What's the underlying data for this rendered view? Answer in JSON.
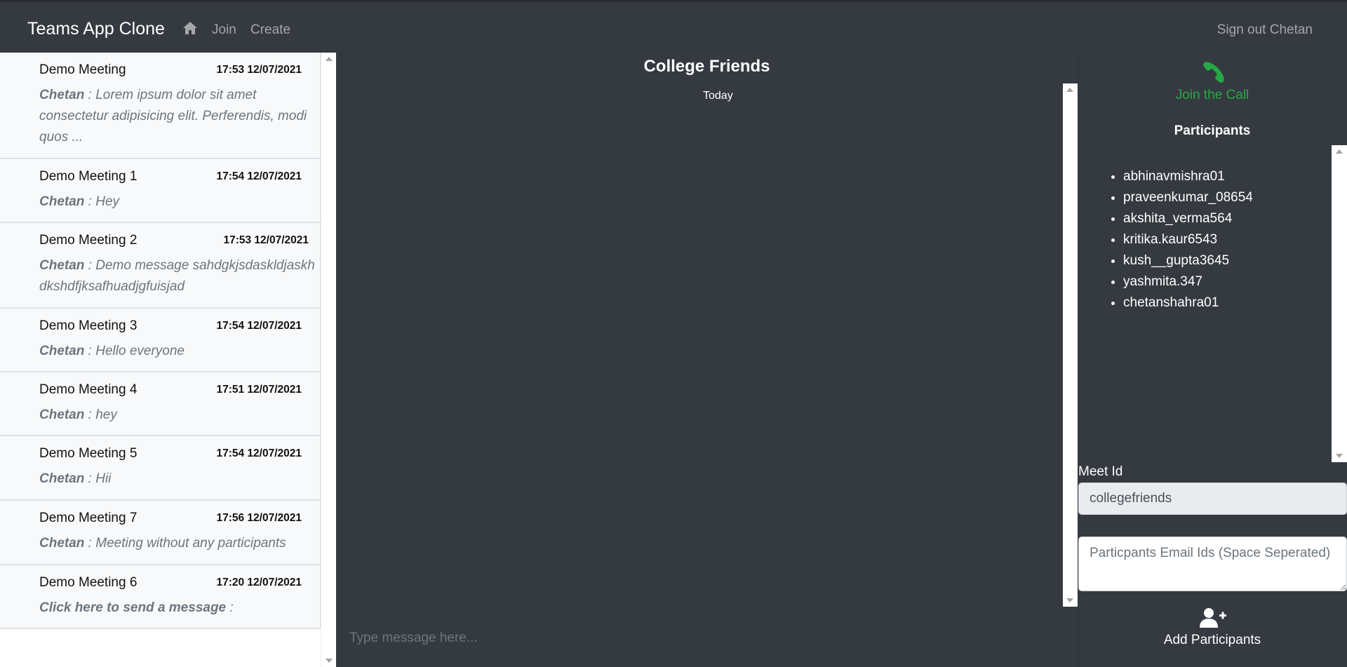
{
  "navbar": {
    "brand": "Teams App Clone",
    "join": "Join",
    "create": "Create",
    "signout": "Sign out Chetan"
  },
  "chats": [
    {
      "title": "Demo Meeting",
      "time": "17:53 12/07/2021",
      "sender": "Chetan",
      "message": " : Lorem ipsum dolor sit amet consectetur adipisicing elit. Perferendis, modi quos ..."
    },
    {
      "title": "Demo Meeting 1",
      "time": "17:54 12/07/2021",
      "sender": "Chetan",
      "message": " : Hey"
    },
    {
      "title": "Demo Meeting 2",
      "time": "17:53 12/07/2021",
      "sender": "Chetan",
      "message": " : Demo message sahdgkjsdaskldjaskhdkshdfjksafhuadjgfuisjad"
    },
    {
      "title": "Demo Meeting 3",
      "time": "17:54 12/07/2021",
      "sender": "Chetan",
      "message": " : Hello everyone"
    },
    {
      "title": "Demo Meeting 4",
      "time": "17:51 12/07/2021",
      "sender": "Chetan",
      "message": " : hey"
    },
    {
      "title": "Demo Meeting 5",
      "time": "17:54 12/07/2021",
      "sender": "Chetan",
      "message": " : Hii"
    },
    {
      "title": "Demo Meeting 7",
      "time": "17:56 12/07/2021",
      "sender": "Chetan",
      "message": " : Meeting without any participants"
    },
    {
      "title": "Demo Meeting 6",
      "time": "17:20 12/07/2021",
      "sender": "Click here to send a message",
      "message": " :"
    }
  ],
  "conversation": {
    "title": "College Friends",
    "day_label": "Today",
    "input_placeholder": "Type message here..."
  },
  "right_panel": {
    "join_call": "Join the Call",
    "participants_title": "Participants",
    "participants": [
      "abhinavmishra01",
      "praveenkumar_08654",
      "akshita_verma564",
      "kritika.kaur6543",
      "kush__gupta3645",
      "yashmita.347",
      "chetanshahra01"
    ],
    "meet_id_label": "Meet Id",
    "meet_id_value": "collegefriends",
    "emails_placeholder": "Particpants Email Ids (Space Seperated)",
    "add_participants": "Add Participants"
  },
  "colors": {
    "background": "#343a40",
    "join_call": "#28a745",
    "list_item_bg": "#f8f9fa"
  },
  "icons": {
    "home": "home-icon",
    "phone": "phone-icon",
    "add_user": "user-plus-icon"
  }
}
